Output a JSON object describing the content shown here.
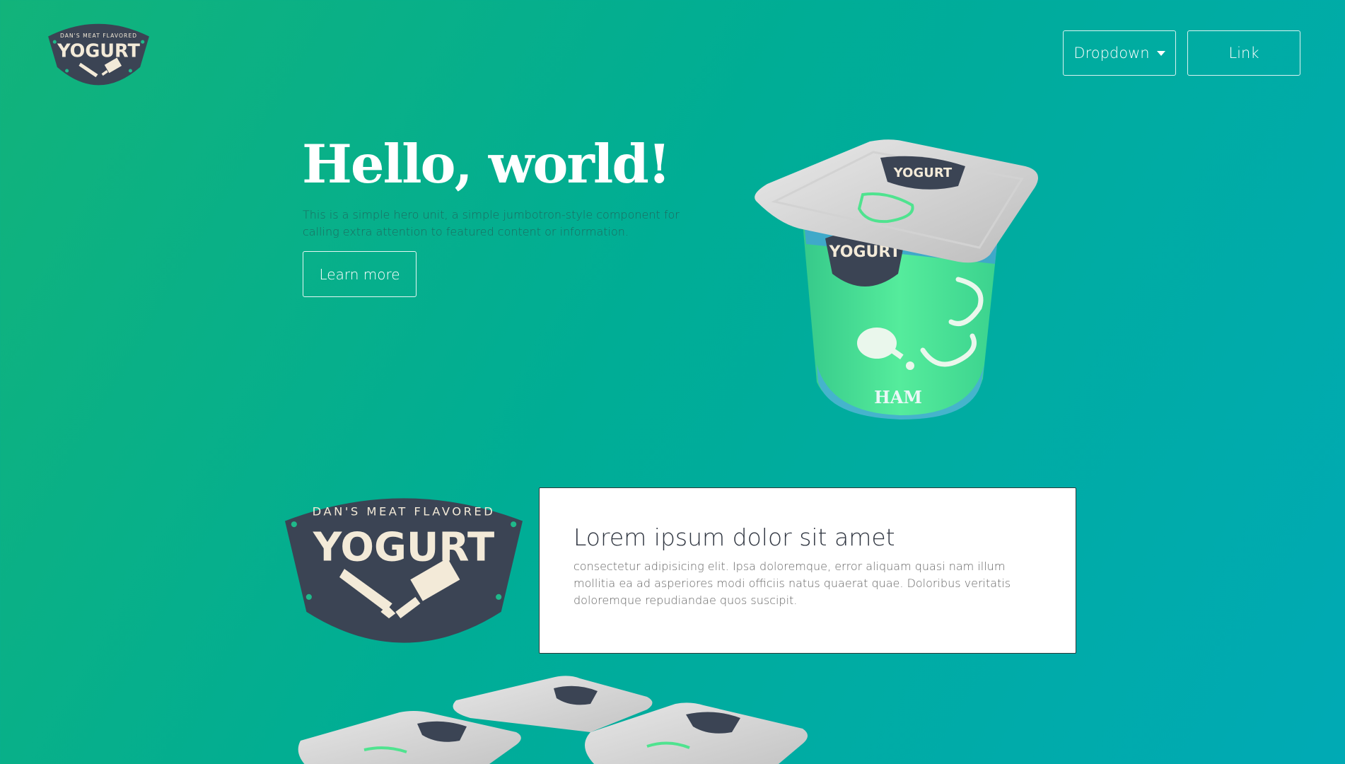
{
  "brand": {
    "tagline": "DAN'S MEAT FLAVORED",
    "name": "YOGURT",
    "colors": {
      "badge": "#3b4454",
      "badge_text": "#f3ead8",
      "accent_dot": "#1fb98a"
    }
  },
  "nav": {
    "dropdown_label": "Dropdown",
    "link_label": "Link"
  },
  "hero": {
    "title": "Hello, world!",
    "text": "This is a simple hero unit, a simple jumbotron-style component for calling extra attention to featured content or information.",
    "button_label": "Learn more"
  },
  "product": {
    "flavor_label": "HAM",
    "colors": {
      "lid": "#dcdcdc",
      "cup_green": "#3fdc8a",
      "cup_blue": "#3fb6c8"
    }
  },
  "card": {
    "title": "Lorem ipsum dolor sit amet",
    "text": "consectetur adipisicing elit. Ipsa doloremque, error aliquam quasi nam illum mollitia ea ad asperiores modi officiis natus quaerat quae. Doloribus veritatis doloremque repudiandae quos suscipit."
  },
  "theme": {
    "gradient_start": "#12b37a",
    "gradient_end": "#00aab5"
  }
}
